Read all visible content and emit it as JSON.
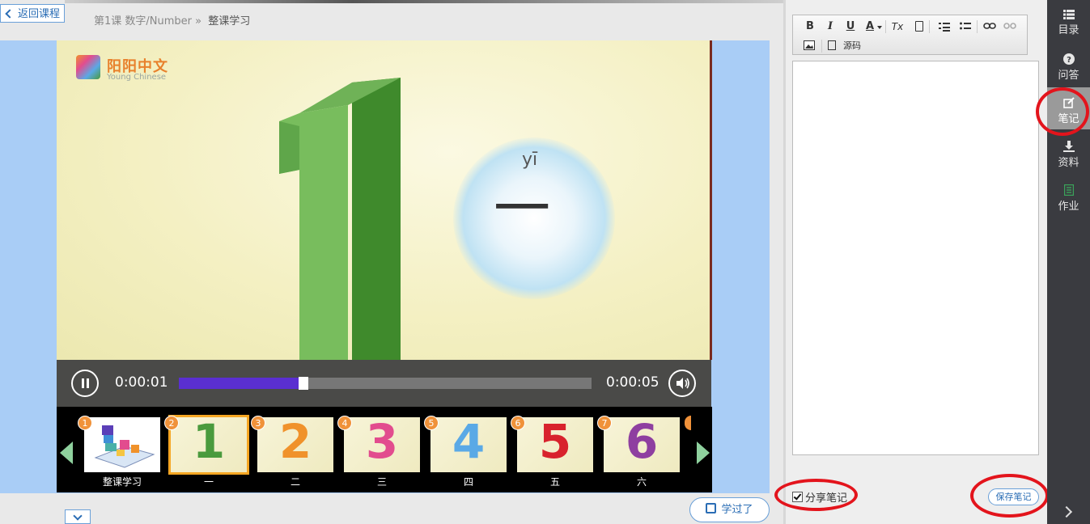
{
  "header": {
    "back_label": "返回课程",
    "breadcrumb_lesson": "第1课  数字/Number »",
    "breadcrumb_current": "整课学习"
  },
  "video": {
    "logo_text": "阳阳中文",
    "logo_sub": "Young Chinese",
    "pinyin": "yī",
    "character": "一",
    "time_current": "0:00:01",
    "time_total": "0:00:05",
    "progress_fraction": 0.29
  },
  "thumbnails": [
    {
      "num": "1",
      "label": "整课学习",
      "glyph": "",
      "color": "#5b3fb8"
    },
    {
      "num": "2",
      "label": "一",
      "glyph": "1",
      "color": "#4a9a3d"
    },
    {
      "num": "3",
      "label": "二",
      "glyph": "2",
      "color": "#f0922b"
    },
    {
      "num": "4",
      "label": "三",
      "glyph": "3",
      "color": "#e24c8e"
    },
    {
      "num": "5",
      "label": "四",
      "glyph": "4",
      "color": "#5aa9e6"
    },
    {
      "num": "6",
      "label": "五",
      "glyph": "5",
      "color": "#d8222c"
    },
    {
      "num": "7",
      "label": "六",
      "glyph": "6",
      "color": "#8e3fa0"
    }
  ],
  "buttons": {
    "learned": "学过了",
    "save_note": "保存笔记",
    "share_note": "分享笔记"
  },
  "toolbar": {
    "bold": "B",
    "italic": "I",
    "underline": "U",
    "font_color": "A",
    "clear_format": "Tx",
    "source_label": "源码"
  },
  "sidenav": [
    {
      "label": "目录",
      "icon": "list-icon"
    },
    {
      "label": "问答",
      "icon": "question-icon"
    },
    {
      "label": "笔记",
      "icon": "edit-icon"
    },
    {
      "label": "资料",
      "icon": "download-icon"
    },
    {
      "label": "作业",
      "icon": "homework-icon"
    }
  ],
  "colors": {
    "accent_blue": "#2a6db5",
    "progress": "#5a2fd1",
    "annotation_red": "#e3141c",
    "selected_thumb": "#f5a623"
  }
}
